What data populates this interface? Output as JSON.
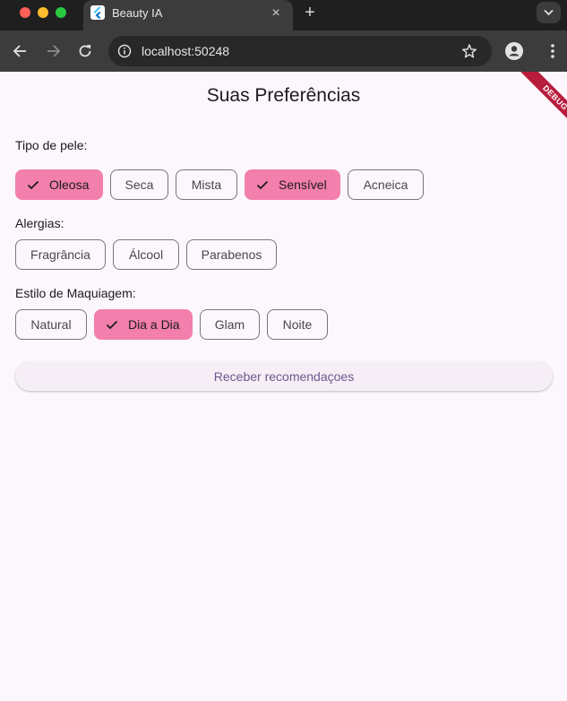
{
  "browser": {
    "tab_title": "Beauty IA",
    "url": "localhost:50248",
    "new_tab_symbol": "+",
    "close_symbol": "×"
  },
  "app": {
    "title": "Suas Preferências",
    "debug_label": "DEBUG",
    "accent_color": "#f27fac"
  },
  "skin": {
    "label": "Tipo de pele:",
    "options": [
      {
        "label": "Oleosa",
        "selected": true
      },
      {
        "label": "Seca",
        "selected": false
      },
      {
        "label": "Mista",
        "selected": false
      },
      {
        "label": "Sensível",
        "selected": true
      },
      {
        "label": "Acneica",
        "selected": false
      }
    ]
  },
  "allergies": {
    "label": "Alergias:",
    "options": [
      {
        "label": "Fragrância",
        "selected": false
      },
      {
        "label": "Álcool",
        "selected": false
      },
      {
        "label": "Parabenos",
        "selected": false
      }
    ]
  },
  "makeup": {
    "label": "Estilo de Maquiagem:",
    "options": [
      {
        "label": "Natural",
        "selected": false
      },
      {
        "label": "Dia a Dia",
        "selected": true
      },
      {
        "label": "Glam",
        "selected": false
      },
      {
        "label": "Noite",
        "selected": false
      }
    ]
  },
  "action": {
    "recommend_label": "Receber recomendaçoes"
  },
  "icons": {
    "selected_chip": "check-icon",
    "back": "arrow-left-icon",
    "forward": "arrow-right-icon",
    "reload": "reload-icon",
    "bookmark": "star-icon",
    "profile": "person-icon",
    "menu": "kebab-icon"
  }
}
